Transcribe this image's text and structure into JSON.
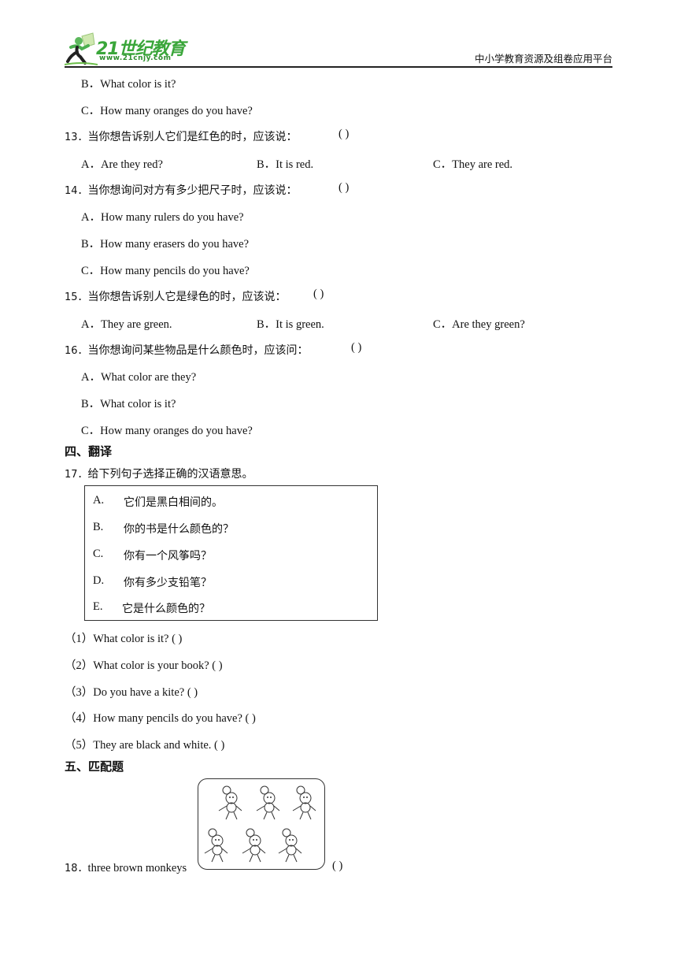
{
  "header": {
    "logo_brand": "21世纪教育",
    "logo_url": "www.21cnjy.com",
    "platform": "中小学教育资源及组卷应用平台"
  },
  "q12_tail": {
    "options": [
      {
        "letter": "B．",
        "text": "What color is it?"
      },
      {
        "letter": "C．",
        "text": "How many oranges do you have?"
      }
    ]
  },
  "q13": {
    "number": "13．",
    "stem": "当你想告诉别人它们是红色的时，应该说：",
    "blank": "(            )",
    "options": [
      {
        "letter": "A．",
        "text": "Are they red?"
      },
      {
        "letter": "B．",
        "text": "It is red."
      },
      {
        "letter": "C．",
        "text": "They are red."
      }
    ]
  },
  "q14": {
    "number": "14．",
    "stem": "当你想询问对方有多少把尺子时，应该说：",
    "blank": "(            )",
    "options": [
      {
        "letter": "A．",
        "text": "How many rulers do you have?"
      },
      {
        "letter": "B．",
        "text": "How many erasers do you have?"
      },
      {
        "letter": "C．",
        "text": "How many pencils do you have?"
      }
    ]
  },
  "q15": {
    "number": "15．",
    "stem": "当你想告诉别人它是绿色的时，应该说：",
    "blank": "(            )",
    "options": [
      {
        "letter": "A．",
        "text": "They are green."
      },
      {
        "letter": "B．",
        "text": "It is green."
      },
      {
        "letter": "C．",
        "text": "Are they green?"
      }
    ]
  },
  "q16": {
    "number": "16．",
    "stem": "当你想询问某些物品是什么颜色时，应该问：",
    "blank": "(            )",
    "options": [
      {
        "letter": "A．",
        "text": "What color are they?"
      },
      {
        "letter": "B．",
        "text": "What color is it?"
      },
      {
        "letter": "C．",
        "text": "How many oranges do you have?"
      }
    ]
  },
  "section4": {
    "title": "四、翻译"
  },
  "q17": {
    "number": "17．",
    "stem": "给下列句子选择正确的汉语意思。",
    "choices": [
      {
        "letter": "A.",
        "text": "它们是黑白相间的。"
      },
      {
        "letter": "B.",
        "text": "你的书是什么颜色的？"
      },
      {
        "letter": "C.",
        "text": "你有一个风筝吗？"
      },
      {
        "letter": "D.",
        "text": "你有多少支铅笔？"
      },
      {
        "letter": "E.",
        "text": "它是什么颜色的？"
      }
    ],
    "items": [
      {
        "index": "（1）",
        "text": "What color is it? (            )"
      },
      {
        "index": "（2）",
        "text": "What color is your book? (            )"
      },
      {
        "index": "（3）",
        "text": "Do you have a kite? (            )"
      },
      {
        "index": "（4）",
        "text": "How many pencils do you have? (            )"
      },
      {
        "index": "（5）",
        "text": "They are black and white. (            )"
      }
    ]
  },
  "section5": {
    "title": "五、匹配题"
  },
  "q18": {
    "number": "18．",
    "text": "three brown monkeys",
    "image_desc": "six monkeys",
    "blank": "(            )"
  }
}
